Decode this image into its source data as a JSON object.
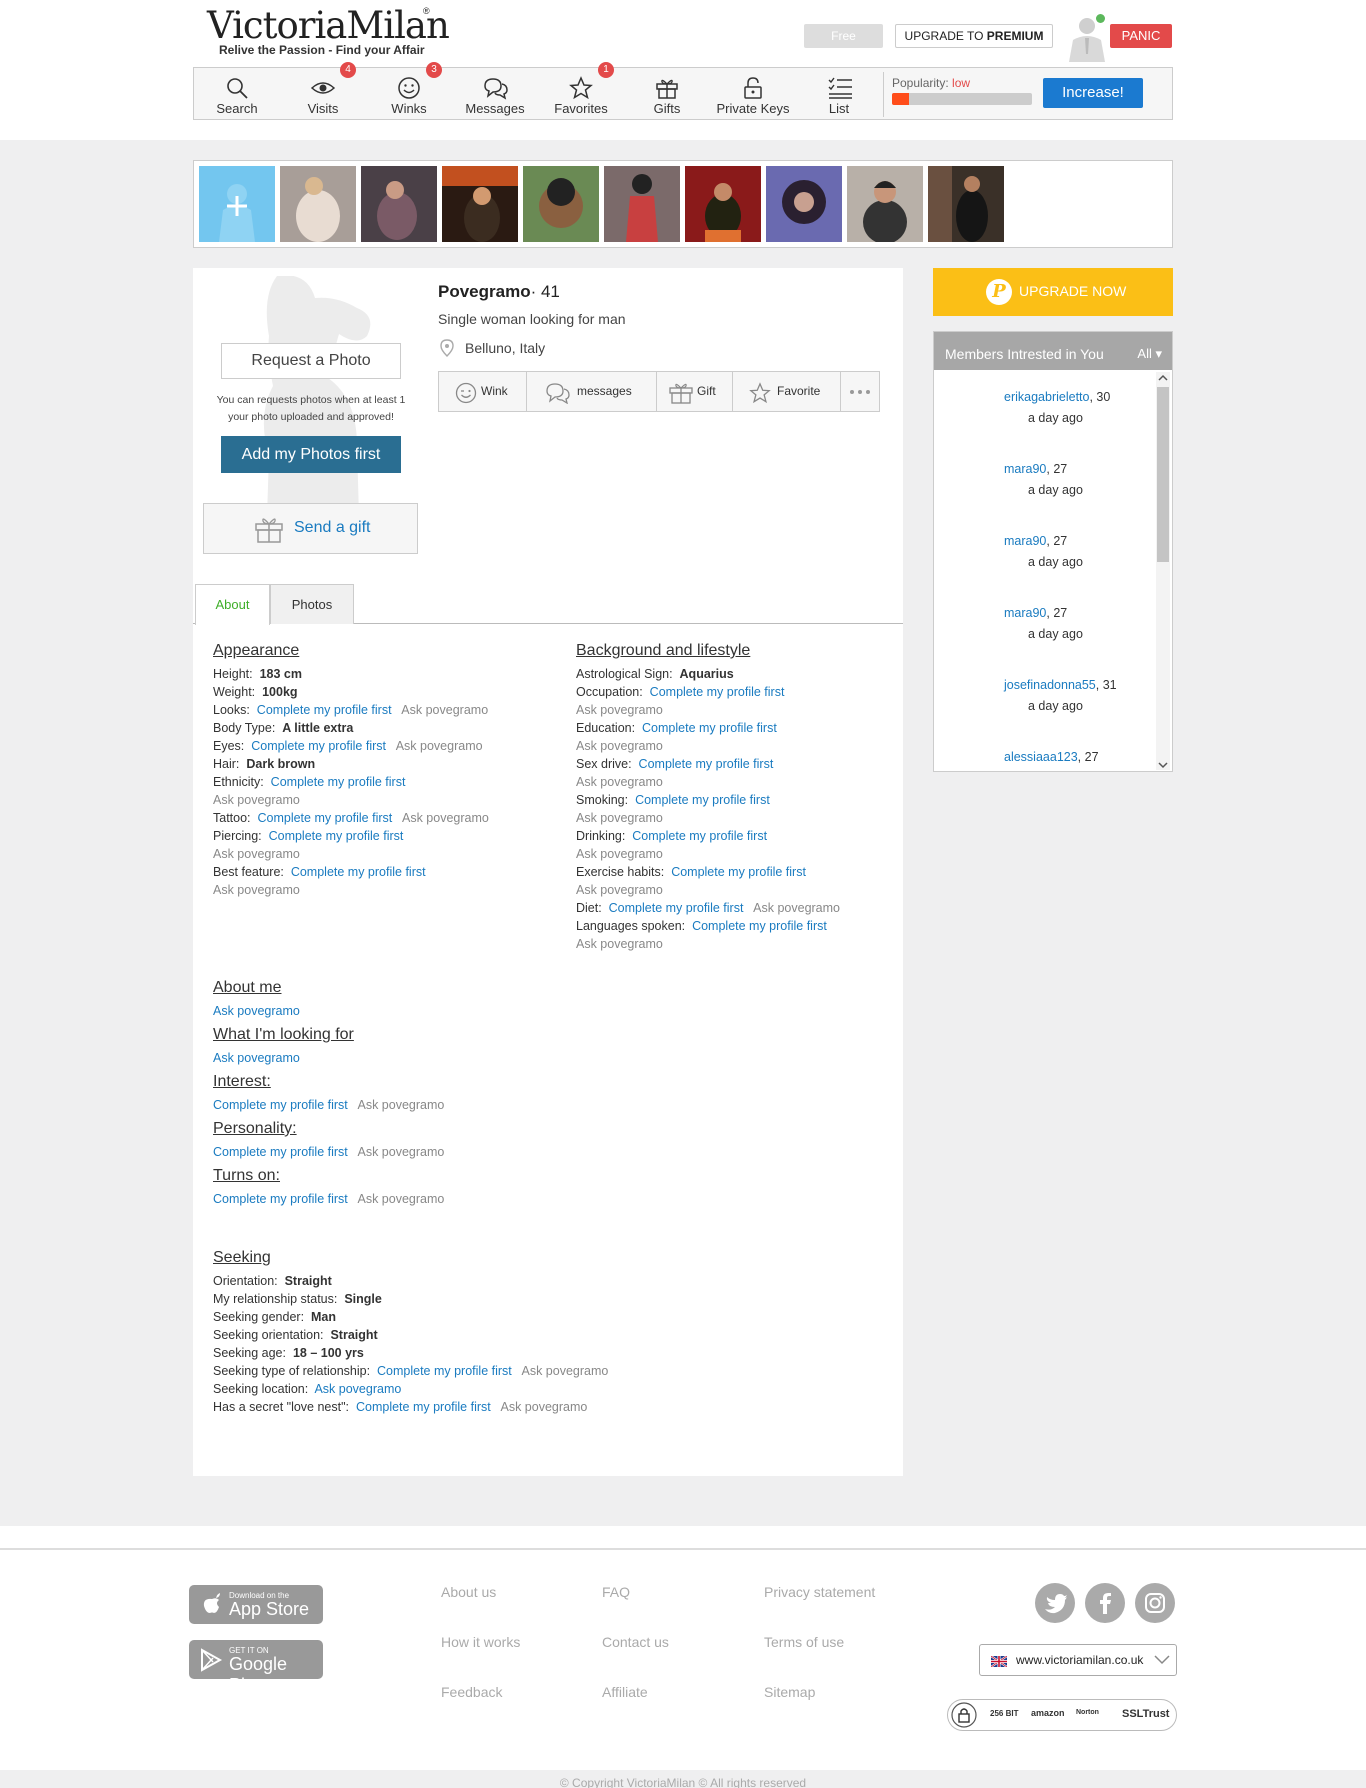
{
  "header": {
    "logo_text": "VictoriaMilan",
    "logo_reg": "®",
    "logo_tagline": "Relive the Passion - Find your Affair",
    "free_label": "Free",
    "upgrade_prefix": "UPGRADE TO ",
    "upgrade_bold": "PREMIUM",
    "panic_label": "PANIC"
  },
  "nav": {
    "items": [
      {
        "label": "Search",
        "icon": "search-icon"
      },
      {
        "label": "Visits",
        "icon": "eye-icon",
        "badge": "4"
      },
      {
        "label": "Winks",
        "icon": "smiley-icon",
        "badge": "3"
      },
      {
        "label": "Messages",
        "icon": "chat-bubbles-icon"
      },
      {
        "label": "Favorites",
        "icon": "star-icon",
        "badge": "1"
      },
      {
        "label": "Gifts",
        "icon": "gift-icon"
      },
      {
        "label": "Private Keys",
        "icon": "padlock-icon"
      },
      {
        "label": "List",
        "icon": "list-icon"
      }
    ],
    "popularity_label": "Popularity:",
    "popularity_value": "low",
    "popularity_fraction": 0.12,
    "increase_label": "Increase!"
  },
  "thumbnails": [
    "add",
    "photo1",
    "photo2",
    "photo3",
    "photo4",
    "photo5",
    "photo6",
    "photo7",
    "photo8",
    "photo9",
    "empty",
    "empty"
  ],
  "profile": {
    "name": "Povegramo",
    "age_sep": "· 41",
    "headline": "Single woman looking for man",
    "location": "Belluno, Italy",
    "request_photo": "Request a Photo",
    "request_note": "You can requests photos when at least 1 your photo uploaded and approved!",
    "add_photos": "Add my Photos first",
    "send_gift": "Send a gift",
    "actions": {
      "wink": "Wink",
      "messages": "messages",
      "gift": "Gift",
      "favorite": "Favorite"
    }
  },
  "tabs": {
    "about": "About",
    "photos": "Photos"
  },
  "complete": "Complete my profile first",
  "ask": "Ask povegramo",
  "appearance": {
    "title": "Appearance",
    "height_label": "Height:",
    "height": "183 cm",
    "weight_label": "Weight:",
    "weight": "100kg",
    "looks_label": "Looks:",
    "body_label": "Body Type:",
    "body": "A little extra",
    "eyes_label": "Eyes:",
    "hair_label": "Hair:",
    "hair": "Dark brown",
    "ethnicity_label": "Ethnicity:",
    "tattoo_label": "Tattoo:",
    "piercing_label": "Piercing:",
    "best_label": "Best feature:"
  },
  "background": {
    "title": "Background and lifestyle",
    "astro_label": "Astrological Sign:",
    "astro": "Aquarius",
    "occupation_label": "Occupation:",
    "education_label": "Education:",
    "sexdrive_label": "Sex drive:",
    "smoking_label": "Smoking:",
    "drinking_label": "Drinking:",
    "exercise_label": "Exercise habits:",
    "diet_label": "Diet:",
    "languages_label": "Languages spoken:"
  },
  "sections": {
    "about_me": "About me",
    "looking_for": "What I'm looking for",
    "interest": "Interest:",
    "personality": "Personality:",
    "turns_on": "Turns on:"
  },
  "seeking": {
    "title": "Seeking",
    "orientation_label": "Orientation:",
    "orientation": "Straight",
    "status_label": "My relationship status:",
    "status": "Single",
    "gender_label": "Seeking gender:",
    "gender": "Man",
    "sorientation_label": "Seeking orientation:",
    "sorientation": "Straight",
    "age_label": "Seeking age:",
    "age": "18 – 100 yrs",
    "type_label": "Seeking type of relationship:",
    "location_label": "Seeking location:",
    "nest_label": "Has a secret \"love nest\":"
  },
  "sidebar": {
    "upgrade_now": "UPGRADE NOW",
    "coin_letter": "P",
    "members_title": "Members Intrested in You",
    "members_filter": "All ▾",
    "members": [
      {
        "name": "erikagabrieletto",
        "age": ", 30",
        "ago": "a day ago"
      },
      {
        "name": "mara90",
        "age": ", 27",
        "ago": "a day ago"
      },
      {
        "name": "mara90",
        "age": ", 27",
        "ago": "a day ago"
      },
      {
        "name": "mara90",
        "age": ", 27",
        "ago": "a day ago"
      },
      {
        "name": "josefinadonna55",
        "age": ", 31",
        "ago": "a day ago"
      },
      {
        "name": "alessiaaa123",
        "age": ", 27",
        "ago": ""
      }
    ]
  },
  "footer": {
    "appstore_small": "Download on the",
    "appstore_big": "App Store",
    "googleplay_small": "GET IT ON",
    "googleplay_big": "Google Play",
    "links": [
      "About us",
      "FAQ",
      "Privacy statement",
      "How it works",
      "Contact us",
      "Terms of use",
      "Feedback",
      "Affiliate",
      "Sitemap"
    ],
    "domain": "www.victoriamilan.co.uk",
    "trust_256": "256 BIT",
    "trust_amazon": "amazon",
    "trust_norton": "Norton",
    "trust_ssl": "SSLTrust",
    "copyright": "© Copyright VictoriaMilan © All rights reserved"
  }
}
